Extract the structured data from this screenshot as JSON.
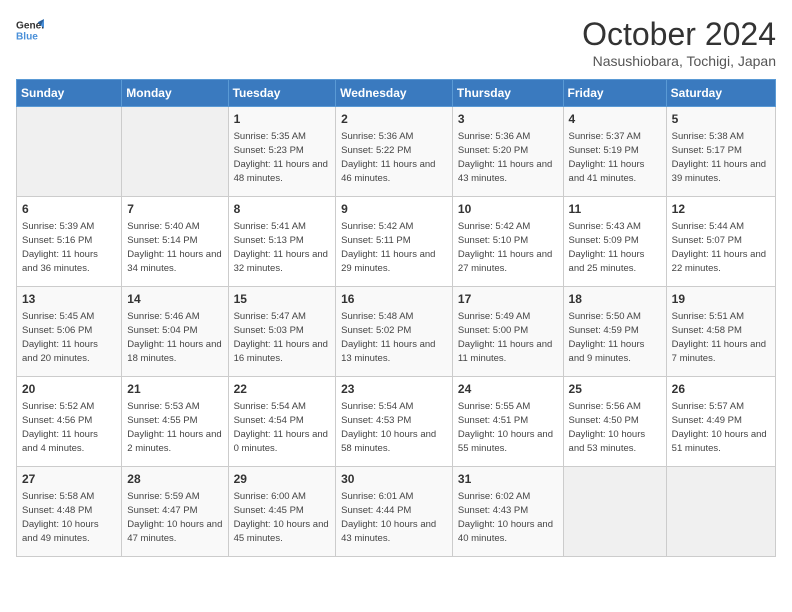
{
  "header": {
    "logo_line1": "General",
    "logo_line2": "Blue",
    "month": "October 2024",
    "location": "Nasushiobara, Tochigi, Japan"
  },
  "weekdays": [
    "Sunday",
    "Monday",
    "Tuesday",
    "Wednesday",
    "Thursday",
    "Friday",
    "Saturday"
  ],
  "weeks": [
    [
      {
        "day": "",
        "empty": true
      },
      {
        "day": "",
        "empty": true
      },
      {
        "day": "1",
        "sunrise": "5:35 AM",
        "sunset": "5:23 PM",
        "daylight": "11 hours and 48 minutes."
      },
      {
        "day": "2",
        "sunrise": "5:36 AM",
        "sunset": "5:22 PM",
        "daylight": "11 hours and 46 minutes."
      },
      {
        "day": "3",
        "sunrise": "5:36 AM",
        "sunset": "5:20 PM",
        "daylight": "11 hours and 43 minutes."
      },
      {
        "day": "4",
        "sunrise": "5:37 AM",
        "sunset": "5:19 PM",
        "daylight": "11 hours and 41 minutes."
      },
      {
        "day": "5",
        "sunrise": "5:38 AM",
        "sunset": "5:17 PM",
        "daylight": "11 hours and 39 minutes."
      }
    ],
    [
      {
        "day": "6",
        "sunrise": "5:39 AM",
        "sunset": "5:16 PM",
        "daylight": "11 hours and 36 minutes."
      },
      {
        "day": "7",
        "sunrise": "5:40 AM",
        "sunset": "5:14 PM",
        "daylight": "11 hours and 34 minutes."
      },
      {
        "day": "8",
        "sunrise": "5:41 AM",
        "sunset": "5:13 PM",
        "daylight": "11 hours and 32 minutes."
      },
      {
        "day": "9",
        "sunrise": "5:42 AM",
        "sunset": "5:11 PM",
        "daylight": "11 hours and 29 minutes."
      },
      {
        "day": "10",
        "sunrise": "5:42 AM",
        "sunset": "5:10 PM",
        "daylight": "11 hours and 27 minutes."
      },
      {
        "day": "11",
        "sunrise": "5:43 AM",
        "sunset": "5:09 PM",
        "daylight": "11 hours and 25 minutes."
      },
      {
        "day": "12",
        "sunrise": "5:44 AM",
        "sunset": "5:07 PM",
        "daylight": "11 hours and 22 minutes."
      }
    ],
    [
      {
        "day": "13",
        "sunrise": "5:45 AM",
        "sunset": "5:06 PM",
        "daylight": "11 hours and 20 minutes."
      },
      {
        "day": "14",
        "sunrise": "5:46 AM",
        "sunset": "5:04 PM",
        "daylight": "11 hours and 18 minutes."
      },
      {
        "day": "15",
        "sunrise": "5:47 AM",
        "sunset": "5:03 PM",
        "daylight": "11 hours and 16 minutes."
      },
      {
        "day": "16",
        "sunrise": "5:48 AM",
        "sunset": "5:02 PM",
        "daylight": "11 hours and 13 minutes."
      },
      {
        "day": "17",
        "sunrise": "5:49 AM",
        "sunset": "5:00 PM",
        "daylight": "11 hours and 11 minutes."
      },
      {
        "day": "18",
        "sunrise": "5:50 AM",
        "sunset": "4:59 PM",
        "daylight": "11 hours and 9 minutes."
      },
      {
        "day": "19",
        "sunrise": "5:51 AM",
        "sunset": "4:58 PM",
        "daylight": "11 hours and 7 minutes."
      }
    ],
    [
      {
        "day": "20",
        "sunrise": "5:52 AM",
        "sunset": "4:56 PM",
        "daylight": "11 hours and 4 minutes."
      },
      {
        "day": "21",
        "sunrise": "5:53 AM",
        "sunset": "4:55 PM",
        "daylight": "11 hours and 2 minutes."
      },
      {
        "day": "22",
        "sunrise": "5:54 AM",
        "sunset": "4:54 PM",
        "daylight": "11 hours and 0 minutes."
      },
      {
        "day": "23",
        "sunrise": "5:54 AM",
        "sunset": "4:53 PM",
        "daylight": "10 hours and 58 minutes."
      },
      {
        "day": "24",
        "sunrise": "5:55 AM",
        "sunset": "4:51 PM",
        "daylight": "10 hours and 55 minutes."
      },
      {
        "day": "25",
        "sunrise": "5:56 AM",
        "sunset": "4:50 PM",
        "daylight": "10 hours and 53 minutes."
      },
      {
        "day": "26",
        "sunrise": "5:57 AM",
        "sunset": "4:49 PM",
        "daylight": "10 hours and 51 minutes."
      }
    ],
    [
      {
        "day": "27",
        "sunrise": "5:58 AM",
        "sunset": "4:48 PM",
        "daylight": "10 hours and 49 minutes."
      },
      {
        "day": "28",
        "sunrise": "5:59 AM",
        "sunset": "4:47 PM",
        "daylight": "10 hours and 47 minutes."
      },
      {
        "day": "29",
        "sunrise": "6:00 AM",
        "sunset": "4:45 PM",
        "daylight": "10 hours and 45 minutes."
      },
      {
        "day": "30",
        "sunrise": "6:01 AM",
        "sunset": "4:44 PM",
        "daylight": "10 hours and 43 minutes."
      },
      {
        "day": "31",
        "sunrise": "6:02 AM",
        "sunset": "4:43 PM",
        "daylight": "10 hours and 40 minutes."
      },
      {
        "day": "",
        "empty": true
      },
      {
        "day": "",
        "empty": true
      }
    ]
  ],
  "labels": {
    "sunrise": "Sunrise:",
    "sunset": "Sunset:",
    "daylight": "Daylight:"
  }
}
